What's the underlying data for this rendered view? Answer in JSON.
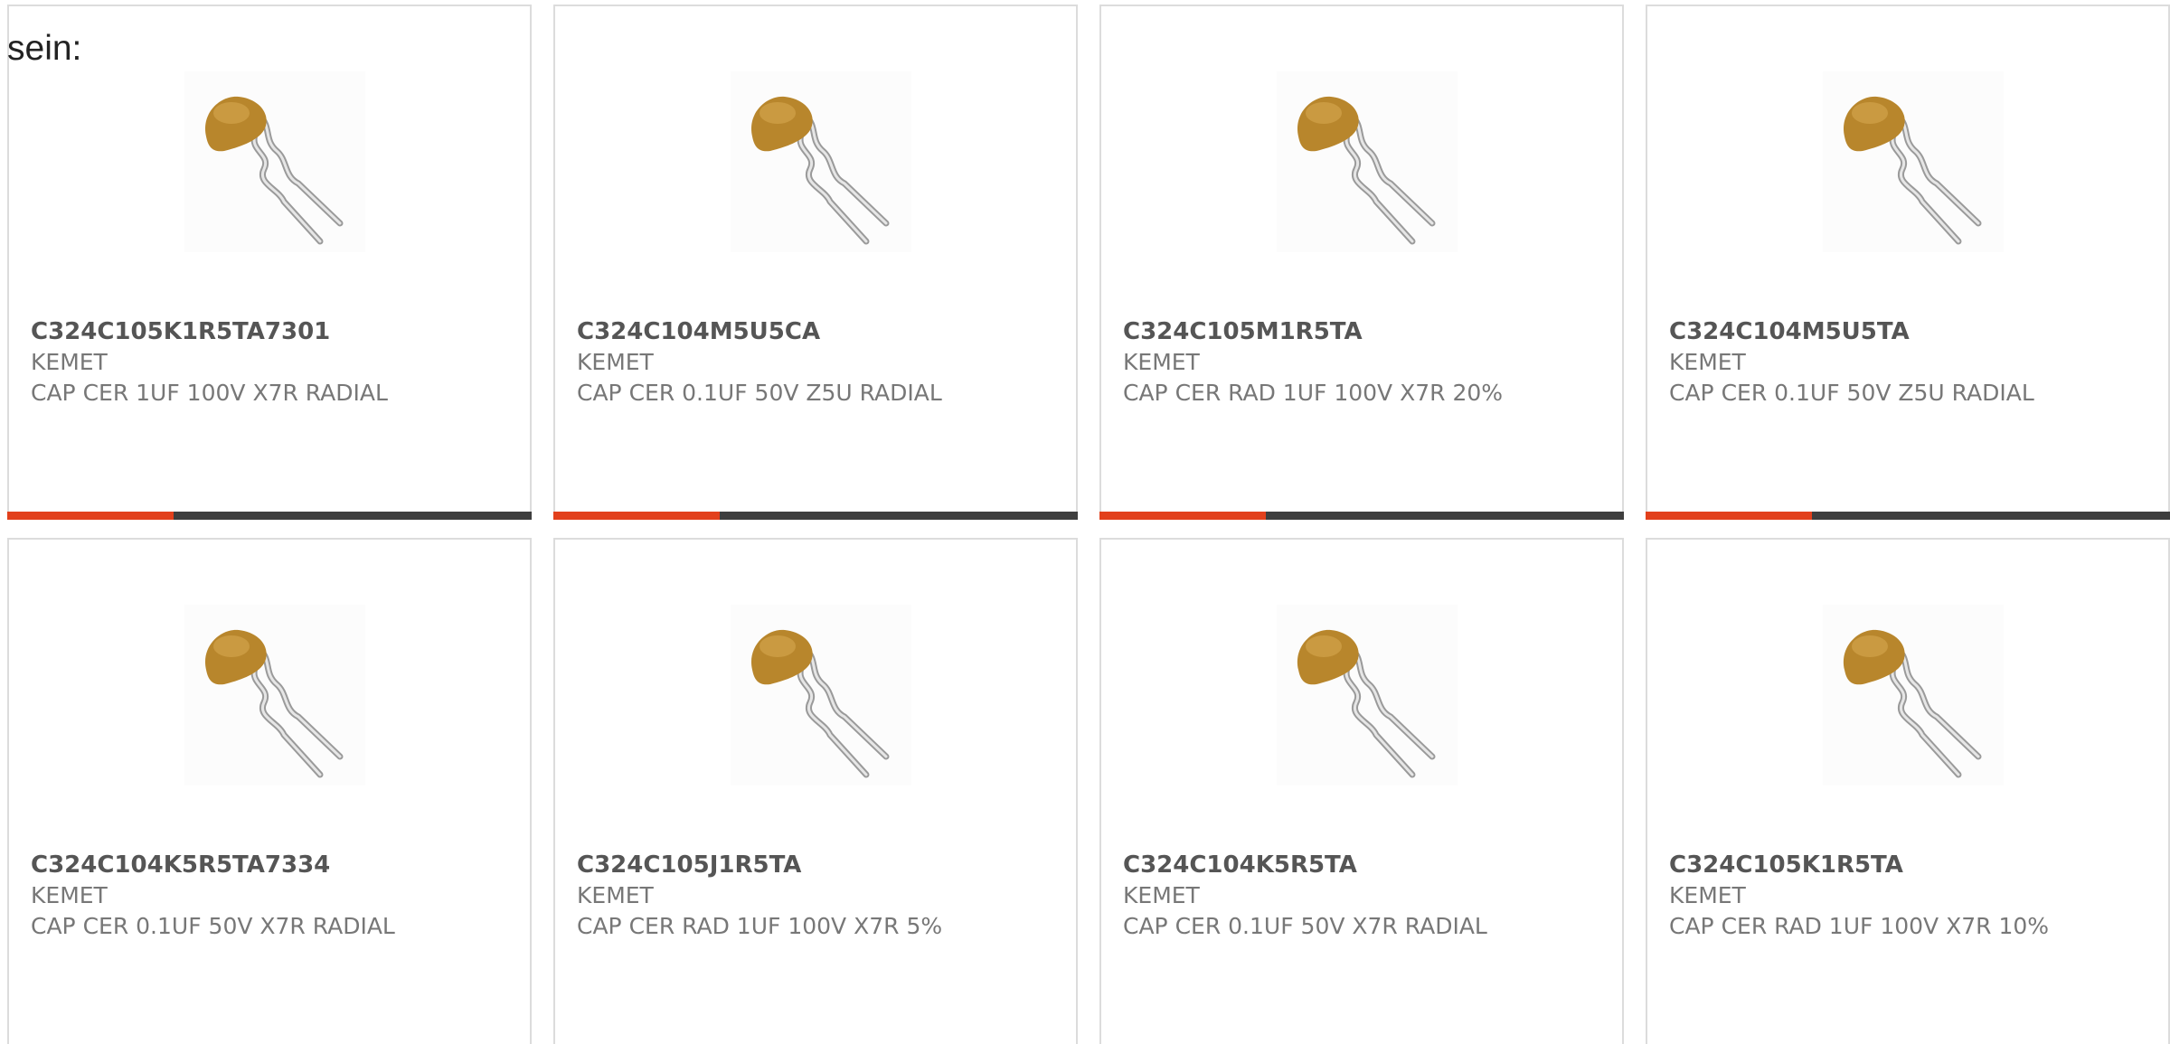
{
  "heading": "sein:",
  "colors": {
    "accent": "#e2401c",
    "bar_dark": "#3e3e3e",
    "part_number": "#555555",
    "secondary_text": "#777777"
  },
  "products": [
    {
      "part_number": "C324C105K1R5TA7301",
      "manufacturer": "KEMET",
      "description": "CAP CER 1UF 100V X7R RADIAL",
      "image": "radial-ceramic-capacitor-icon"
    },
    {
      "part_number": "C324C104M5U5CA",
      "manufacturer": "KEMET",
      "description": "CAP CER 0.1UF 50V Z5U RADIAL",
      "image": "radial-ceramic-capacitor-icon"
    },
    {
      "part_number": "C324C105M1R5TA",
      "manufacturer": "KEMET",
      "description": "CAP CER RAD 1UF 100V X7R 20%",
      "image": "radial-ceramic-capacitor-icon"
    },
    {
      "part_number": "C324C104M5U5TA",
      "manufacturer": "KEMET",
      "description": "CAP CER 0.1UF 50V Z5U RADIAL",
      "image": "radial-ceramic-capacitor-icon"
    },
    {
      "part_number": "C324C104K5R5TA7334",
      "manufacturer": "KEMET",
      "description": "CAP CER 0.1UF 50V X7R RADIAL",
      "image": "radial-ceramic-capacitor-icon"
    },
    {
      "part_number": "C324C105J1R5TA",
      "manufacturer": "KEMET",
      "description": "CAP CER RAD 1UF 100V X7R 5%",
      "image": "radial-ceramic-capacitor-icon"
    },
    {
      "part_number": "C324C104K5R5TA",
      "manufacturer": "KEMET",
      "description": "CAP CER 0.1UF 50V X7R RADIAL",
      "image": "radial-ceramic-capacitor-icon"
    },
    {
      "part_number": "C324C105K1R5TA",
      "manufacturer": "KEMET",
      "description": "CAP CER RAD 1UF 100V X7R 10%",
      "image": "radial-ceramic-capacitor-icon"
    }
  ]
}
